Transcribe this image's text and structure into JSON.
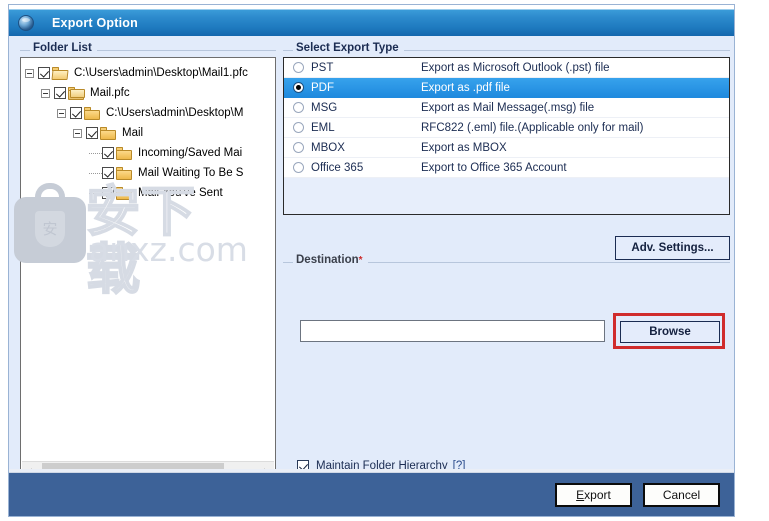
{
  "window": {
    "title": "Export Option",
    "app_icon": "globe-icon"
  },
  "folder_list": {
    "label": "Folder List",
    "nodes": [
      {
        "depth": 0,
        "expander": "minus",
        "checked": true,
        "icon": "open-folder-icon",
        "label": "C:\\Users\\admin\\Desktop\\Mail1.pfc"
      },
      {
        "depth": 1,
        "expander": "minus",
        "checked": true,
        "icon": "stacked-folders-icon",
        "label": "Mail.pfc"
      },
      {
        "depth": 2,
        "expander": "minus",
        "checked": true,
        "icon": "folder-icon",
        "label": "C:\\Users\\admin\\Desktop\\M"
      },
      {
        "depth": 3,
        "expander": "minus",
        "checked": true,
        "icon": "folder-icon",
        "label": "Mail"
      },
      {
        "depth": 4,
        "expander": "none",
        "checked": true,
        "icon": "folder-icon",
        "label": "Incoming/Saved Mai"
      },
      {
        "depth": 4,
        "expander": "none",
        "checked": true,
        "icon": "folder-icon",
        "label": "Mail Waiting To Be S"
      },
      {
        "depth": 4,
        "expander": "none",
        "checked": true,
        "icon": "folder-icon",
        "label": "Mail You've Sent"
      }
    ],
    "scrollbar": {
      "left_arrow": "‹",
      "right_arrow": "›"
    }
  },
  "export_type": {
    "label": "Select Export Type",
    "selected": "PDF",
    "rows": [
      {
        "name": "PST",
        "description": "Export as Microsoft Outlook (.pst) file",
        "selected": false
      },
      {
        "name": "PDF",
        "description": "Export as .pdf file",
        "selected": true
      },
      {
        "name": "MSG",
        "description": "Export as Mail Message(.msg) file",
        "selected": false
      },
      {
        "name": "EML",
        "description": "RFC822 (.eml) file.(Applicable only for mail)",
        "selected": false
      },
      {
        "name": "MBOX",
        "description": "Export as MBOX",
        "selected": false
      },
      {
        "name": "Office 365",
        "description": "Export to Office 365 Account",
        "selected": false
      }
    ]
  },
  "watermark": {
    "chinese": "安下载",
    "url": "anxz.com",
    "shield_glyph": "安"
  },
  "adv_settings": {
    "label": "Adv. Settings..."
  },
  "destination": {
    "label": "Destination",
    "required_marker": "*",
    "path_value": "",
    "path_placeholder": "",
    "browse_label": "Browse",
    "highlight_color": "#d02c2c"
  },
  "maintain_hierarchy": {
    "label": "Maintain Folder Hierarchy",
    "help_label": "[?]",
    "checked": true
  },
  "footer": {
    "export_label": "Export",
    "export_accel": "E",
    "export_rest": "xport",
    "cancel_label": "Cancel"
  },
  "colors": {
    "titlebar_top": "#3a9bd9",
    "titlebar_bottom": "#1467ad",
    "dialog_bg": "#e2ebfa",
    "selection_blue": "#2f9ae8",
    "footer_blue": "#3d6298",
    "highlight_red": "#d02c2c"
  }
}
